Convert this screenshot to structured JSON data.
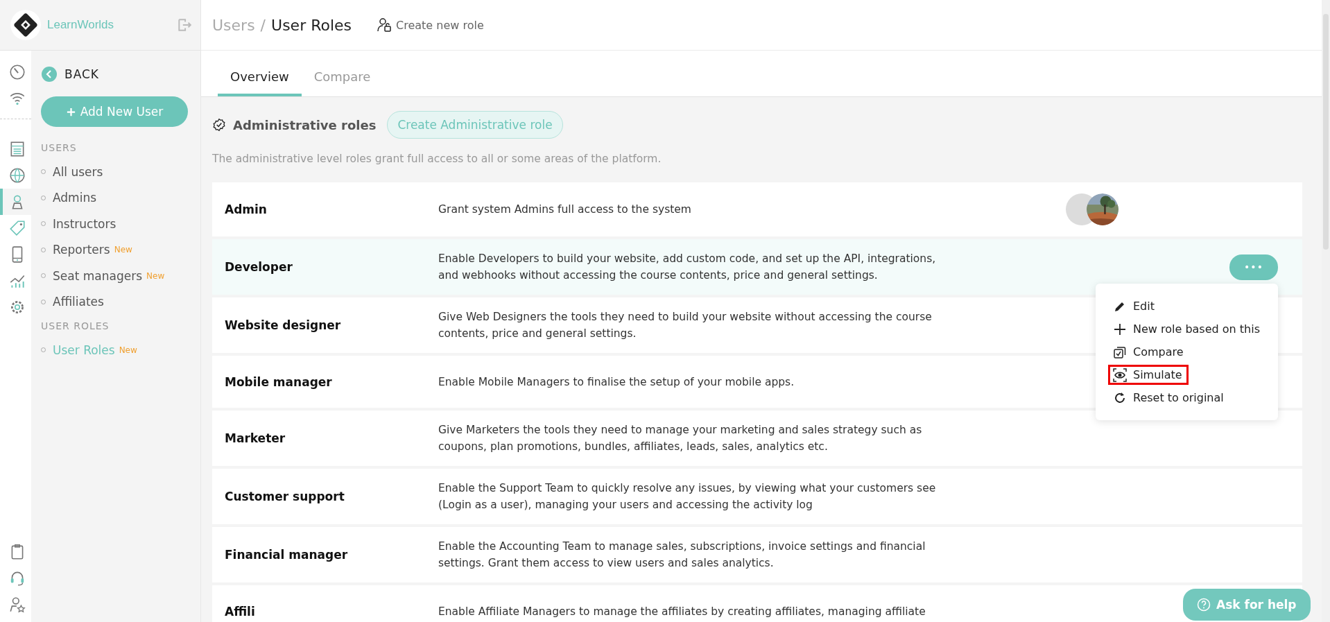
{
  "brand": {
    "name": "LearnWorlds"
  },
  "rail": {
    "top": [
      {
        "selected": false
      },
      {
        "selected": false
      }
    ],
    "middle": [
      {
        "selected": false
      },
      {
        "selected": false
      },
      {
        "selected": true
      },
      {
        "selected": false
      },
      {
        "selected": false
      },
      {
        "selected": false
      },
      {
        "selected": false
      }
    ],
    "bottom": [
      {
        "selected": false
      },
      {
        "selected": false
      },
      {
        "selected": false
      }
    ]
  },
  "sidebar": {
    "back": "BACK",
    "add_button": "Add New User",
    "sections": [
      {
        "title": "USERS",
        "items": [
          {
            "label": "All users",
            "selected": false
          },
          {
            "label": "Admins",
            "selected": false
          },
          {
            "label": "Instructors",
            "selected": false
          },
          {
            "label": "Reporters",
            "badge": "New",
            "selected": false
          },
          {
            "label": "Seat managers",
            "badge": "New",
            "selected": false
          },
          {
            "label": "Affiliates",
            "selected": false
          }
        ]
      },
      {
        "title": "USER ROLES",
        "items": [
          {
            "label": "User Roles",
            "badge": "New",
            "selected": true
          }
        ]
      }
    ]
  },
  "header": {
    "breadcrumb_parent": "Users",
    "separator": "/",
    "title": "User Roles",
    "action": "Create new role"
  },
  "tabs": [
    {
      "label": "Overview",
      "selected": true
    },
    {
      "label": "Compare",
      "selected": false
    }
  ],
  "section": {
    "title": "Administrative roles",
    "button": "Create Administrative role",
    "description": "The administrative level roles grant full access to all or some areas of the platform."
  },
  "roles": [
    {
      "name": "Admin",
      "description": "Grant system Admins full access to the system",
      "avatars": [
        {
          "kind": "placeholder"
        },
        {
          "kind": "picture"
        }
      ],
      "highlighted": false
    },
    {
      "name": "Developer",
      "description": "Enable Developers to build your website, add custom code, and set up the API, integrations, and webhooks without accessing the course contents, price and general settings.",
      "highlighted": true,
      "menu_button": "•••"
    },
    {
      "name": "Website designer",
      "description": "Give Web Designers the tools they need to build your website without accessing the course contents, price and general settings.",
      "highlighted": false
    },
    {
      "name": "Mobile manager",
      "description": "Enable Mobile Managers to finalise the setup of your mobile apps.",
      "highlighted": false
    },
    {
      "name": "Marketer",
      "description": "Give Marketers the tools they need to manage your marketing and sales strategy such as coupons, plan promotions, bundles, affiliates, leads, sales, analytics etc.",
      "highlighted": false
    },
    {
      "name": "Customer support",
      "description": "Enable the Support Team to quickly resolve any issues, by viewing what your customers see (Login as a user), managing your users and accessing the activity log",
      "highlighted": false
    },
    {
      "name": "Financial manager",
      "description": "Enable the Accounting Team to manage sales, subscriptions, invoice settings and financial settings. Grant them access to view users and sales analytics.",
      "highlighted": false
    },
    {
      "name": "Affili",
      "description": "Enable Affiliate Managers to manage the affiliates by creating affiliates, managing affiliate",
      "highlighted": false
    }
  ],
  "menu": [
    {
      "label": "Edit",
      "kind": "edit",
      "highlighted": false
    },
    {
      "label": "New role based on this",
      "kind": "add",
      "highlighted": false
    },
    {
      "label": "Compare",
      "kind": "compare",
      "highlighted": false
    },
    {
      "label": "Simulate",
      "kind": "simulate",
      "highlighted": true
    },
    {
      "label": "Reset to original",
      "kind": "reset",
      "highlighted": false
    }
  ],
  "help_button": "Ask for help"
}
